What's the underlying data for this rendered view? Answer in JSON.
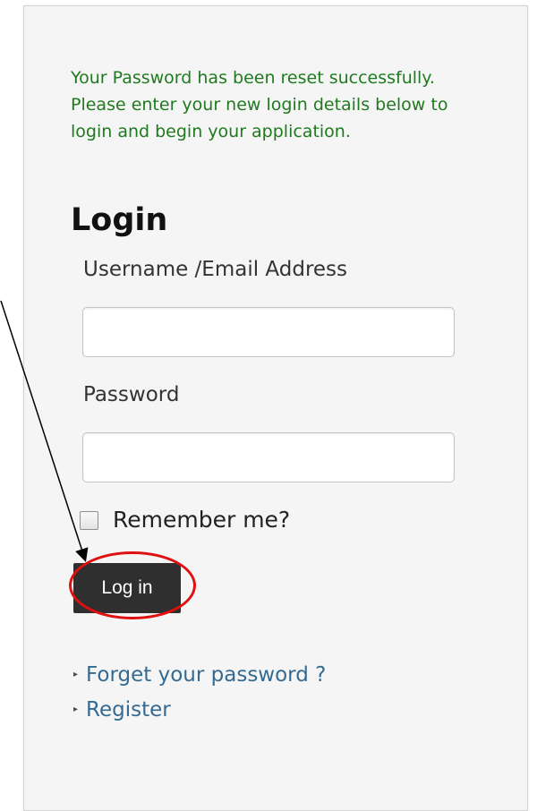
{
  "message": "Your Password has been reset successfully. Please enter your new login details below to login and begin your application.",
  "login": {
    "title": "Login",
    "username_label": "Username /Email Address",
    "username_value": "",
    "password_label": "Password",
    "password_value": "",
    "remember_label": "Remember me?",
    "remember_checked": false,
    "button_label": "Log in"
  },
  "links": [
    {
      "label": "Forget your password ?"
    },
    {
      "label": "Register"
    }
  ],
  "annotation": {
    "arrow_icon": "arrow-icon",
    "highlight_icon": "red-circle-highlight",
    "color": "#e01010",
    "arrow_color": "#000000"
  },
  "colors": {
    "message": "#1f7a1f",
    "link": "#356a91",
    "button": "#2f2f2f",
    "panel": "#f5f5f5"
  }
}
